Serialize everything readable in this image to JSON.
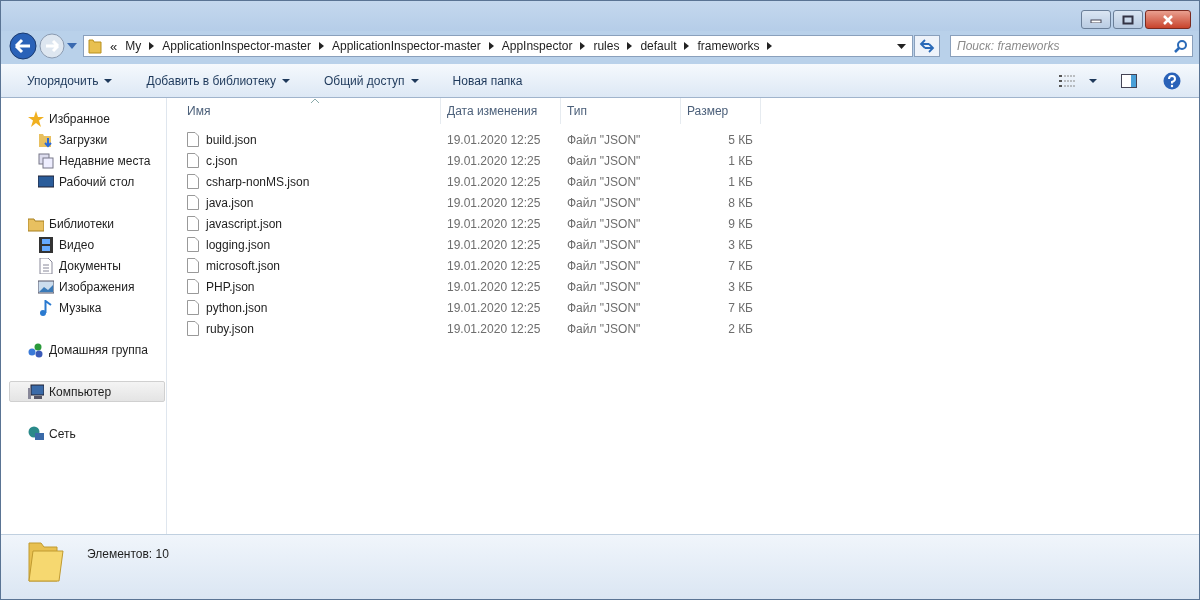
{
  "address": {
    "overflow": "«",
    "crumbs": [
      "My",
      "ApplicationInspector-master",
      "ApplicationInspector-master",
      "AppInspector",
      "rules",
      "default",
      "frameworks"
    ]
  },
  "search": {
    "placeholder": "Поиск: frameworks"
  },
  "toolbar": {
    "items": [
      {
        "label": "Упорядочить",
        "dropdown": true
      },
      {
        "label": "Добавить в библиотеку",
        "dropdown": true
      },
      {
        "label": "Общий доступ",
        "dropdown": true
      },
      {
        "label": "Новая папка",
        "dropdown": false
      }
    ]
  },
  "sidebar": {
    "sections": [
      {
        "label": "Избранное",
        "kind": "star",
        "selected": false,
        "children": [
          {
            "label": "Загрузки",
            "kind": "downloads",
            "selected": false
          },
          {
            "label": "Недавние места",
            "kind": "recent",
            "selected": false
          },
          {
            "label": "Рабочий стол",
            "kind": "desktop",
            "selected": false
          }
        ]
      },
      {
        "label": "Библиотеки",
        "kind": "library",
        "selected": false,
        "children": [
          {
            "label": "Видео",
            "kind": "video",
            "selected": false
          },
          {
            "label": "Документы",
            "kind": "documents",
            "selected": false
          },
          {
            "label": "Изображения",
            "kind": "pictures",
            "selected": false
          },
          {
            "label": "Музыка",
            "kind": "music",
            "selected": false
          }
        ]
      },
      {
        "label": "Домашняя группа",
        "kind": "homegroup",
        "selected": false
      },
      {
        "label": "Компьютер",
        "kind": "computer",
        "selected": true
      },
      {
        "label": "Сеть",
        "kind": "network",
        "selected": false
      }
    ]
  },
  "table": {
    "columns": [
      {
        "label": "Имя",
        "sorted": true
      },
      {
        "label": "Дата изменения",
        "sorted": false
      },
      {
        "label": "Тип",
        "sorted": false
      },
      {
        "label": "Размер",
        "sorted": false
      }
    ],
    "rows": [
      [
        "build.json",
        "19.01.2020 12:25",
        "Файл \"JSON\"",
        "5 КБ"
      ],
      [
        "c.json",
        "19.01.2020 12:25",
        "Файл \"JSON\"",
        "1 КБ"
      ],
      [
        "csharp-nonMS.json",
        "19.01.2020 12:25",
        "Файл \"JSON\"",
        "1 КБ"
      ],
      [
        "java.json",
        "19.01.2020 12:25",
        "Файл \"JSON\"",
        "8 КБ"
      ],
      [
        "javascript.json",
        "19.01.2020 12:25",
        "Файл \"JSON\"",
        "9 КБ"
      ],
      [
        "logging.json",
        "19.01.2020 12:25",
        "Файл \"JSON\"",
        "3 КБ"
      ],
      [
        "microsoft.json",
        "19.01.2020 12:25",
        "Файл \"JSON\"",
        "7 КБ"
      ],
      [
        "PHP.json",
        "19.01.2020 12:25",
        "Файл \"JSON\"",
        "3 КБ"
      ],
      [
        "python.json",
        "19.01.2020 12:25",
        "Файл \"JSON\"",
        "7 КБ"
      ],
      [
        "ruby.json",
        "19.01.2020 12:25",
        "Файл \"JSON\"",
        "2 КБ"
      ]
    ]
  },
  "status_bar": {
    "text": "Элементов: 10"
  }
}
